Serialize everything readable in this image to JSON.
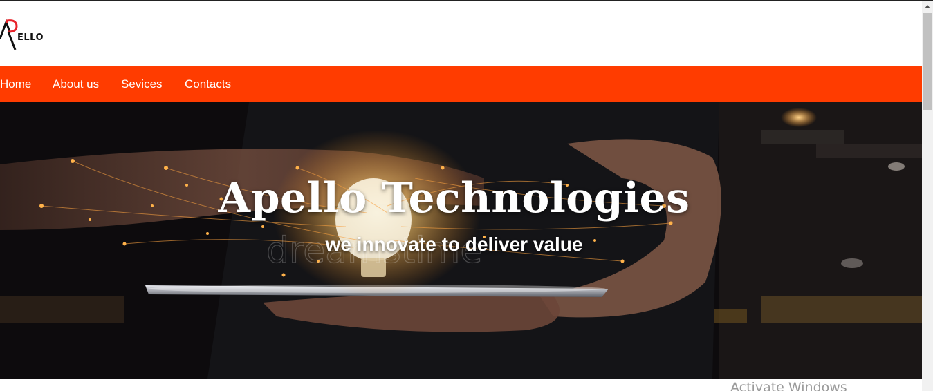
{
  "header": {
    "logo_text": "APELLO"
  },
  "nav": {
    "items": [
      {
        "label": "Home"
      },
      {
        "label": "About us"
      },
      {
        "label": "Sevices"
      },
      {
        "label": "Contacts"
      }
    ],
    "background_color": "#ff3c00"
  },
  "hero": {
    "title": "Apello Technologies",
    "subtitle": "we innovate to deliver value",
    "watermark_text": "dreamstime"
  },
  "os_overlay": {
    "activate_windows": "Activate Windows"
  }
}
